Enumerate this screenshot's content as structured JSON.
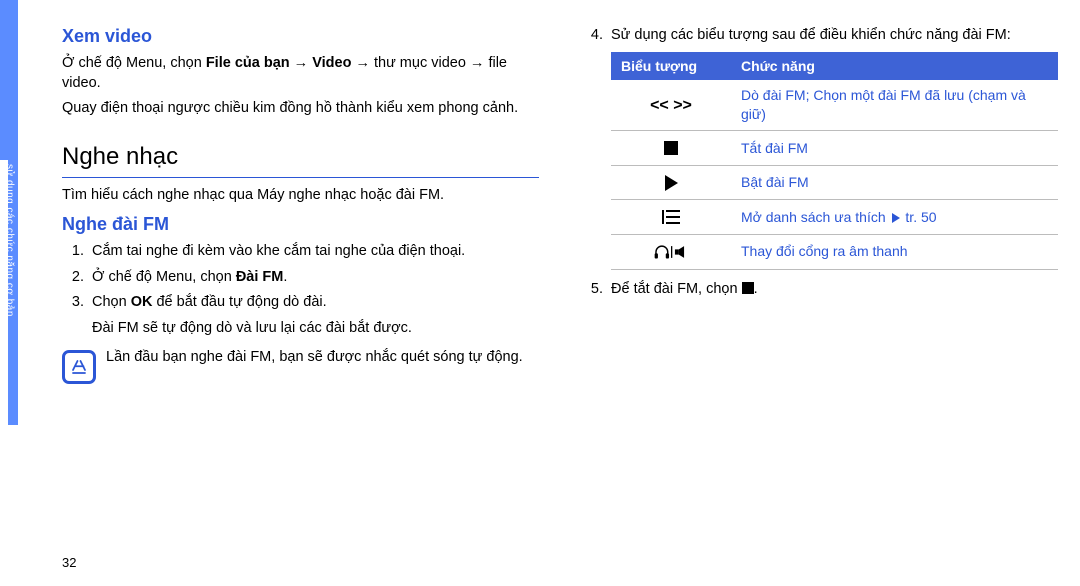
{
  "side_label": "sử dụng các chức năng cơ bản",
  "page_number": "32",
  "left": {
    "h_video": "Xem video",
    "video_p1_prefix": "Ở chế độ Menu, chọn ",
    "video_p1_bold1": "File của bạn",
    "video_p1_mid": " → ",
    "video_p1_bold2": "Video",
    "video_p1_suffix": " → thư mục video → file video.",
    "video_p2": "Quay điện thoại ngược chiều kim đồng hồ thành kiểu xem phong cảnh.",
    "h_music": "Nghe nhạc",
    "music_intro": "Tìm hiểu cách nghe nhạc qua Máy nghe nhạc hoặc đài FM.",
    "h_fm": "Nghe đài FM",
    "ol": {
      "i1": "Cắm tai nghe đi kèm vào khe cắm tai nghe của điện thoại.",
      "i2_prefix": "Ở chế độ Menu, chọn ",
      "i2_bold": "Đài FM",
      "i2_suffix": ".",
      "i3a_prefix": "Chọn ",
      "i3a_bold": "OK",
      "i3a_suffix": " để bắt đầu tự động dò đài.",
      "i3b": "Đài FM sẽ tự động dò và lưu lại các đài bắt được."
    },
    "note": "Lần đầu bạn nghe đài FM, bạn sẽ được nhắc quét sóng tự động."
  },
  "right": {
    "step4": "Sử dụng các biểu tượng sau để điều khiển chức năng đài FM:",
    "th_icon": "Biểu tượng",
    "th_func": "Chức năng",
    "row1_icon": "<< >>",
    "row1_func": "Dò đài FM; Chọn một đài FM đã lưu (chạm và giữ)",
    "row2_func": "Tắt đài FM",
    "row3_func": "Bật đài FM",
    "row4_func_prefix": "Mở danh sách ưa thích ",
    "row4_func_suffix": " tr. 50",
    "row5_func": "Thay đổi cổng ra âm thanh",
    "step5_prefix": "Để tắt đài FM, chọn ",
    "step5_suffix": "."
  }
}
